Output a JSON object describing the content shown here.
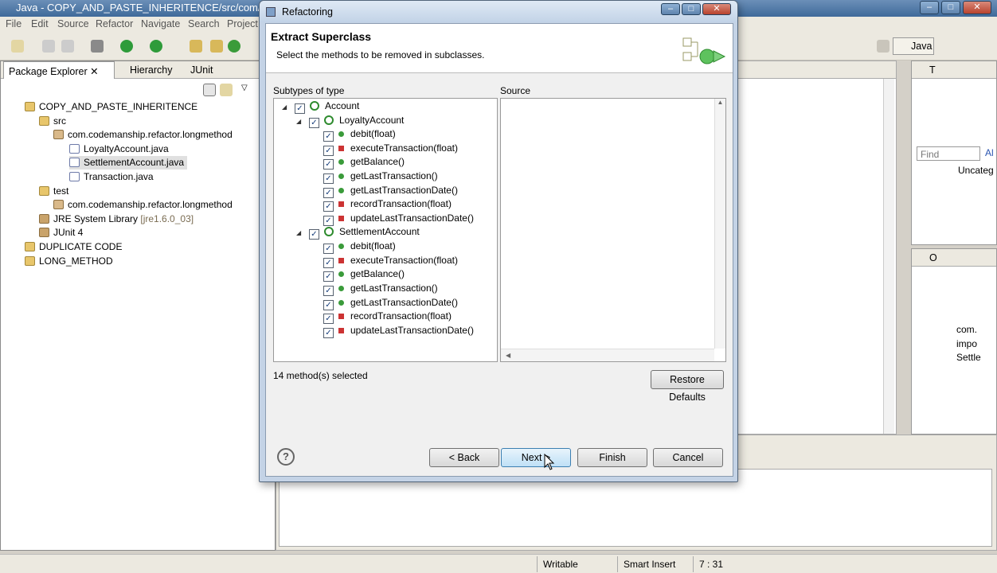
{
  "window": {
    "title": "Java - COPY_AND_PASTE_INHERITENCE/src/com/codemar"
  },
  "menu": [
    "File",
    "Edit",
    "Source",
    "Refactor",
    "Navigate",
    "Search",
    "Project"
  ],
  "perspective": {
    "label": "Java"
  },
  "package_explorer": {
    "tabs": [
      {
        "label": "Package Explorer"
      },
      {
        "label": "Hierarchy"
      },
      {
        "label": "JUnit"
      }
    ],
    "tree": [
      {
        "label": "COPY_AND_PASTE_INHERITENCE",
        "icon": "project-icon"
      },
      {
        "label": "src",
        "icon": "source-folder-icon"
      },
      {
        "label": "com.codemanship.refactor.longmethod",
        "icon": "package-icon"
      },
      {
        "label": "LoyaltyAccount.java",
        "icon": "java-file-icon"
      },
      {
        "label": "SettlementAccount.java",
        "icon": "java-file-icon"
      },
      {
        "label": "Transaction.java",
        "icon": "java-file-icon"
      },
      {
        "label": "test",
        "icon": "source-folder-icon"
      },
      {
        "label": "com.codemanship.refactor.longmethod",
        "icon": "package-icon"
      },
      {
        "label": "JRE System Library",
        "suffix": "[jre1.6.0_03]",
        "icon": "library-icon"
      },
      {
        "label": "JUnit 4",
        "icon": "library-icon"
      },
      {
        "label": "DUPLICATE CODE",
        "icon": "project-icon"
      },
      {
        "label": "LONG_METHOD",
        "icon": "project-icon"
      }
    ]
  },
  "right_panel": {
    "tab_top": "T",
    "find_placeholder": "Find",
    "filter_label": "Al",
    "uncategorized": "Uncateg",
    "tab_outline": "O",
    "outline_items": [
      "com.",
      "impo",
      "Settle"
    ]
  },
  "dialog": {
    "title": "Refactoring",
    "heading": "Extract Superclass",
    "description": "Select the methods to be removed in subclasses.",
    "subtypes_label": "Subtypes of type",
    "source_label": "Source",
    "root": "Account",
    "classes": [
      {
        "name": "LoyaltyAccount",
        "methods": [
          {
            "name": "debit(float)",
            "vis": "public"
          },
          {
            "name": "executeTransaction(float)",
            "vis": "private"
          },
          {
            "name": "getBalance()",
            "vis": "public"
          },
          {
            "name": "getLastTransaction()",
            "vis": "public"
          },
          {
            "name": "getLastTransactionDate()",
            "vis": "public"
          },
          {
            "name": "recordTransaction(float)",
            "vis": "private"
          },
          {
            "name": "updateLastTransactionDate()",
            "vis": "private"
          }
        ]
      },
      {
        "name": "SettlementAccount",
        "methods": [
          {
            "name": "debit(float)",
            "vis": "public"
          },
          {
            "name": "executeTransaction(float)",
            "vis": "private"
          },
          {
            "name": "getBalance()",
            "vis": "public"
          },
          {
            "name": "getLastTransaction()",
            "vis": "public"
          },
          {
            "name": "getLastTransactionDate()",
            "vis": "public"
          },
          {
            "name": "recordTransaction(float)",
            "vis": "private"
          },
          {
            "name": "updateLastTransactionDate()",
            "vis": "private"
          }
        ]
      }
    ],
    "selected_count": "14 method(s) selected",
    "restore_defaults": "Restore Defaults",
    "help": "?",
    "back": "< Back",
    "next": "Next >",
    "finish": "Finish",
    "cancel": "Cancel"
  },
  "status": {
    "writable": "Writable",
    "insert_mode": "Smart Insert",
    "position": "7 : 31"
  }
}
